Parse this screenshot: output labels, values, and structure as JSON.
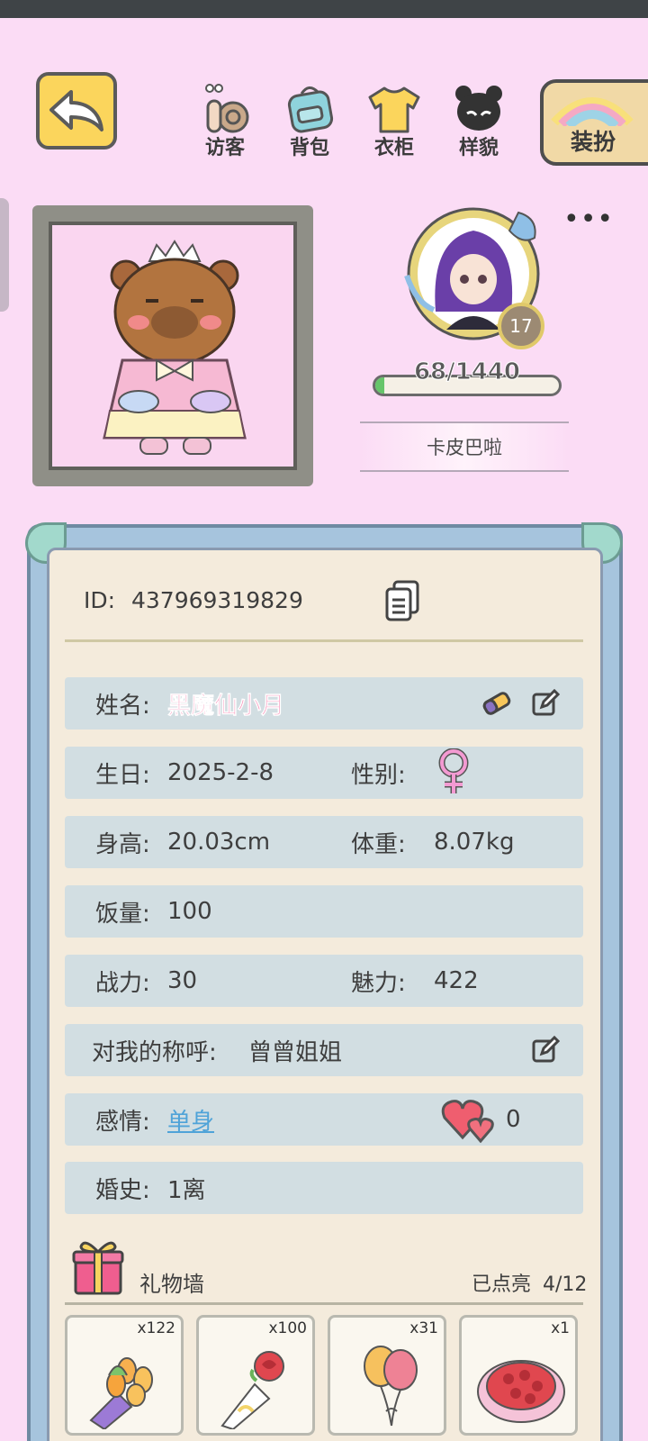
{
  "top_nav": {
    "items": [
      {
        "label": "访客",
        "icon": "snail-icon"
      },
      {
        "label": "背包",
        "icon": "backpack-icon"
      },
      {
        "label": "衣柜",
        "icon": "tshirt-icon"
      },
      {
        "label": "样貌",
        "icon": "panda-face-icon"
      }
    ],
    "dress_label": "装扮"
  },
  "profile": {
    "level": "17",
    "xp_text": "68/1440",
    "xp_fraction": 0.047,
    "nickname": "卡皮巴啦",
    "id_label": "ID:",
    "id_value": "437969319829"
  },
  "info": {
    "name_label": "姓名:",
    "name_value": "黑魔仙小月",
    "birthday_label": "生日:",
    "birthday_value": "2025-2-8",
    "gender_label": "性别:",
    "gender_icon": "female-symbol-icon",
    "height_label": "身高:",
    "height_value": "20.03cm",
    "weight_label": "体重:",
    "weight_value": "8.07kg",
    "food_label": "饭量:",
    "food_value": "100",
    "power_label": "战力:",
    "power_value": "30",
    "charm_label": "魅力:",
    "charm_value": "422",
    "callname_label": "对我的称呼:",
    "callname_value": "曾曾姐姐",
    "relationship_label": "感情:",
    "relationship_value": "单身",
    "hearts_count": "0",
    "marriage_label": "婚史:",
    "marriage_value": "1离"
  },
  "gifts": {
    "title": "礼物墙",
    "lit_label": "已点亮",
    "lit_count": "4/12",
    "items": [
      {
        "qty": "x122",
        "icon": "tulip-bouquet-icon"
      },
      {
        "qty": "x100",
        "icon": "rose-bouquet-icon"
      },
      {
        "qty": "x31",
        "icon": "balloons-icon"
      },
      {
        "qty": "x1",
        "icon": "rose-basket-icon"
      }
    ]
  },
  "colors": {
    "background": "#fbdcf5",
    "accent_yellow": "#fbd55c",
    "name_pink": "#f675a6",
    "link_blue": "#4fa3d8",
    "row_bg": "#d2dee2"
  }
}
